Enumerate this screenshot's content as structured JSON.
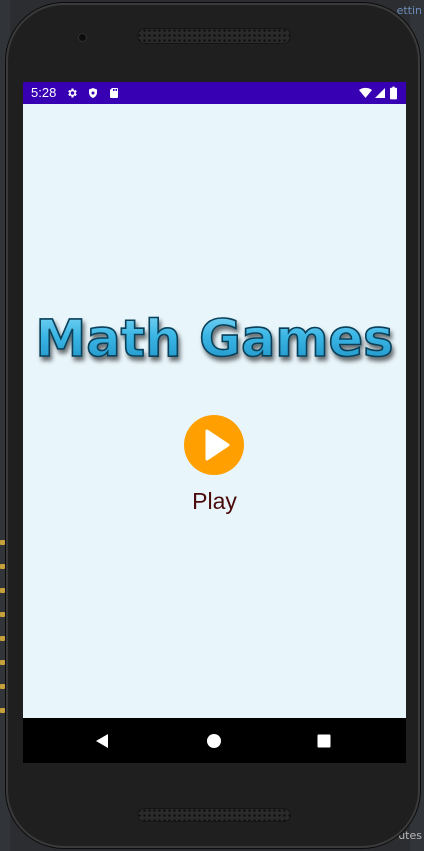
{
  "ide": {
    "top_right_text": "ettin",
    "bottom_right_text": "utes",
    "left_text": "w\nic\nnt\nw"
  },
  "device": {
    "status_bar": {
      "time": "5:28",
      "left_icons": [
        "gear-icon",
        "shield-icon",
        "sd-card-icon"
      ],
      "right_icons": [
        "wifi-icon",
        "signal-icon",
        "battery-icon"
      ],
      "color": "#3700b3"
    },
    "app": {
      "title": "Math Games",
      "play_label": "Play",
      "play_icon": "play-icon",
      "background": "#e8f5fb",
      "accent": "#ffa000"
    },
    "nav_bar": {
      "back": "back-icon",
      "home": "home-icon",
      "recents": "recents-icon"
    }
  }
}
